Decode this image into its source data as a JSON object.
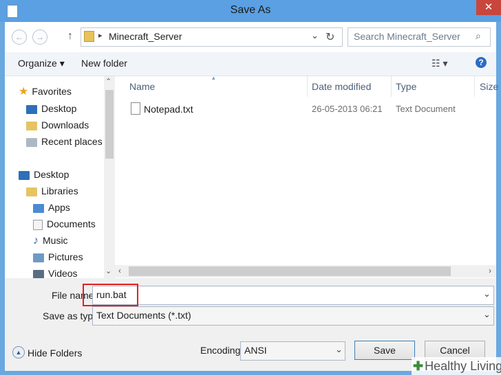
{
  "window": {
    "title": "Save As",
    "close_glyph": "✕"
  },
  "nav": {
    "back_glyph": "←",
    "forward_glyph": "→",
    "up_glyph": "↑",
    "address_path": "Minecraft_Server",
    "address_sep": "▸",
    "refresh_glyph": "↻",
    "search_placeholder": "Search Minecraft_Server"
  },
  "toolbar": {
    "organize_label": "Organize ▾",
    "new_folder_label": "New folder",
    "view_glyph": "☷ ▾",
    "help_glyph": "?"
  },
  "navpane": {
    "favorites": {
      "label": "Favorites",
      "items": [
        "Desktop",
        "Downloads",
        "Recent places"
      ]
    },
    "desktop": {
      "label": "Desktop"
    },
    "libraries": {
      "label": "Libraries",
      "items": [
        "Apps",
        "Documents",
        "Music",
        "Pictures",
        "Videos"
      ]
    }
  },
  "filelist": {
    "columns": [
      "Name",
      "Date modified",
      "Type",
      "Size"
    ],
    "rows": [
      {
        "name": "Notepad.txt",
        "modified": "26-05-2013 06:21",
        "type": "Text Document"
      }
    ]
  },
  "form": {
    "file_name_label": "File name:",
    "file_name_value": "run.bat",
    "save_as_type_label": "Save as type:",
    "save_as_type_value": "Text Documents (*.txt)",
    "encoding_label": "Encoding:",
    "encoding_value": "ANSI",
    "hide_folders_label": "Hide Folders",
    "save_label": "Save",
    "cancel_label": "Cancel"
  },
  "colors": {
    "titlebar": "#5aa0e2",
    "highlight_box": "#e0201e",
    "close": "#c9463d"
  },
  "watermark": {
    "text": "Healthy Living"
  }
}
